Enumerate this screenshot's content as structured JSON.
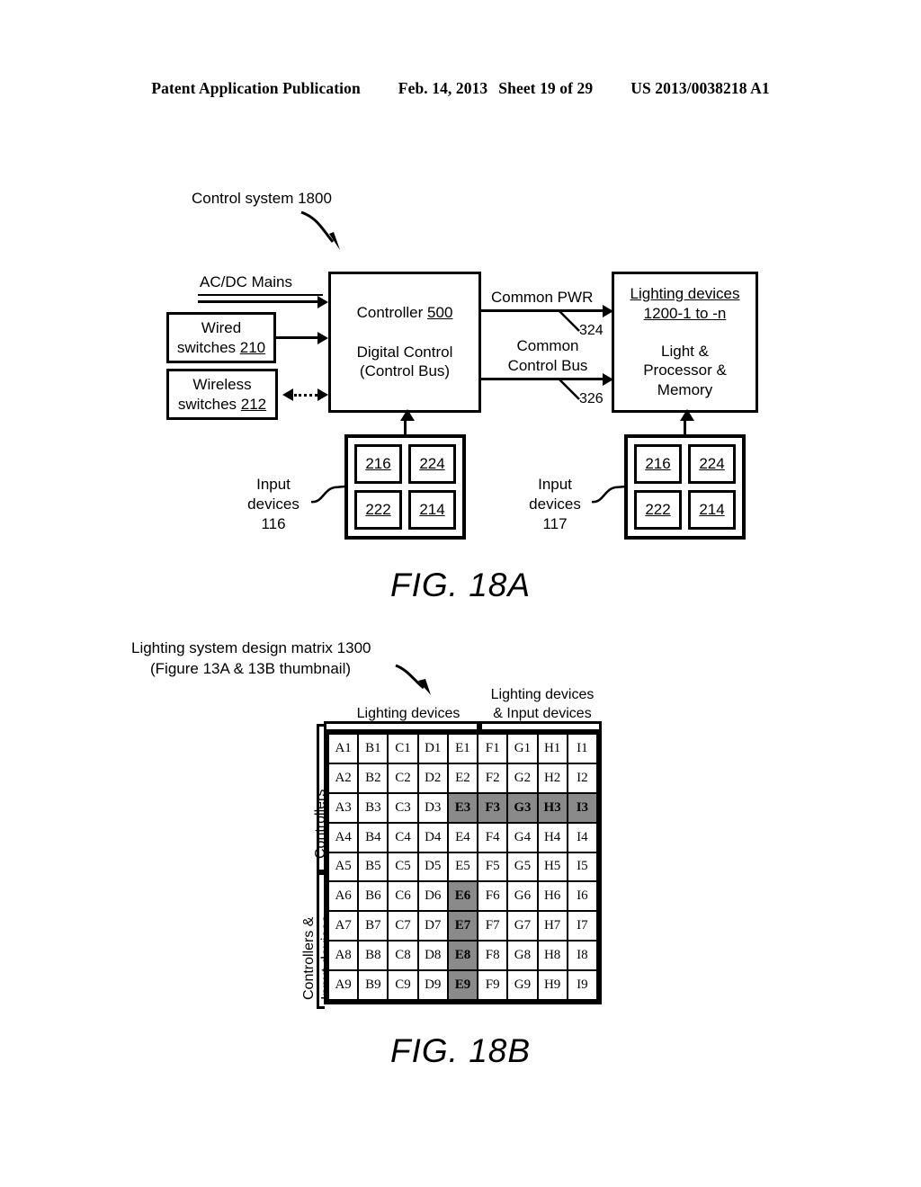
{
  "header": {
    "publication": "Patent Application Publication",
    "date": "Feb. 14, 2013",
    "sheet": "Sheet 19 of 29",
    "number": "US 2013/0038218 A1"
  },
  "fig18a": {
    "caption": "FIG. 18A",
    "system_label": "Control system 1800",
    "mains_label": "AC/DC Mains",
    "wired_switches": {
      "line1": "Wired",
      "line2": "switches",
      "ref": "210"
    },
    "wireless_switches": {
      "line1": "Wireless",
      "line2": "switches",
      "ref": "212"
    },
    "controller": {
      "title": "Controller",
      "ref": "500",
      "line2": "Digital Control",
      "line3": "(Control Bus)"
    },
    "common_pwr_label": "Common PWR",
    "common_pwr_ref": "324",
    "common_control_bus_line1": "Common",
    "common_control_bus_line2": "Control Bus",
    "common_control_bus_ref": "326",
    "lighting_devices": {
      "title": "Lighting devices",
      "ref": "1200-1 to -n",
      "line3": "Light &",
      "line4": "Processor &",
      "line5": "Memory"
    },
    "input_devices_left": {
      "line1": "Input",
      "line2": "devices",
      "ref": "116",
      "cells": [
        "216",
        "224",
        "222",
        "214"
      ]
    },
    "input_devices_right": {
      "line1": "Input",
      "line2": "devices",
      "ref": "117",
      "cells": [
        "216",
        "224",
        "222",
        "214"
      ]
    }
  },
  "fig18b": {
    "caption": "FIG. 18B",
    "title_line1": "Lighting system design matrix 1300",
    "title_line2": "(Figure 13A & 13B thumbnail)",
    "col_group_1": "Lighting devices",
    "col_group_2_line1": "Lighting devices",
    "col_group_2_line2": "& Input devices",
    "row_group_1": "Controllers",
    "row_group_2_line1": "Controllers &",
    "row_group_2_line2": "Input devices",
    "highlight_color": "#8a8a8a",
    "matrix": {
      "columns": [
        "A",
        "B",
        "C",
        "D",
        "E",
        "F",
        "G",
        "H",
        "I"
      ],
      "rows": [
        1,
        2,
        3,
        4,
        5,
        6,
        7,
        8,
        9
      ],
      "cells": [
        [
          {
            "t": "A1",
            "h": false
          },
          {
            "t": "B1",
            "h": false
          },
          {
            "t": "C1",
            "h": false
          },
          {
            "t": "D1",
            "h": false
          },
          {
            "t": "E1",
            "h": false
          },
          {
            "t": "F1",
            "h": false
          },
          {
            "t": "G1",
            "h": false
          },
          {
            "t": "H1",
            "h": false
          },
          {
            "t": "I1",
            "h": false
          }
        ],
        [
          {
            "t": "A2",
            "h": false
          },
          {
            "t": "B2",
            "h": false
          },
          {
            "t": "C2",
            "h": false
          },
          {
            "t": "D2",
            "h": false
          },
          {
            "t": "E2",
            "h": false
          },
          {
            "t": "F2",
            "h": false
          },
          {
            "t": "G2",
            "h": false
          },
          {
            "t": "H2",
            "h": false
          },
          {
            "t": "I2",
            "h": false
          }
        ],
        [
          {
            "t": "A3",
            "h": false
          },
          {
            "t": "B3",
            "h": false
          },
          {
            "t": "C3",
            "h": false
          },
          {
            "t": "D3",
            "h": false
          },
          {
            "t": "E3",
            "h": true
          },
          {
            "t": "F3",
            "h": true
          },
          {
            "t": "G3",
            "h": true
          },
          {
            "t": "H3",
            "h": true
          },
          {
            "t": "I3",
            "h": true
          }
        ],
        [
          {
            "t": "A4",
            "h": false
          },
          {
            "t": "B4",
            "h": false
          },
          {
            "t": "C4",
            "h": false
          },
          {
            "t": "D4",
            "h": false
          },
          {
            "t": "E4",
            "h": false
          },
          {
            "t": "F4",
            "h": false
          },
          {
            "t": "G4",
            "h": false
          },
          {
            "t": "H4",
            "h": false
          },
          {
            "t": "I4",
            "h": false
          }
        ],
        [
          {
            "t": "A5",
            "h": false
          },
          {
            "t": "B5",
            "h": false
          },
          {
            "t": "C5",
            "h": false
          },
          {
            "t": "D5",
            "h": false
          },
          {
            "t": "E5",
            "h": false
          },
          {
            "t": "F5",
            "h": false
          },
          {
            "t": "G5",
            "h": false
          },
          {
            "t": "H5",
            "h": false
          },
          {
            "t": "I5",
            "h": false
          }
        ],
        [
          {
            "t": "A6",
            "h": false
          },
          {
            "t": "B6",
            "h": false
          },
          {
            "t": "C6",
            "h": false
          },
          {
            "t": "D6",
            "h": false
          },
          {
            "t": "E6",
            "h": true
          },
          {
            "t": "F6",
            "h": false
          },
          {
            "t": "G6",
            "h": false
          },
          {
            "t": "H6",
            "h": false
          },
          {
            "t": "I6",
            "h": false
          }
        ],
        [
          {
            "t": "A7",
            "h": false
          },
          {
            "t": "B7",
            "h": false
          },
          {
            "t": "C7",
            "h": false
          },
          {
            "t": "D7",
            "h": false
          },
          {
            "t": "E7",
            "h": true
          },
          {
            "t": "F7",
            "h": false
          },
          {
            "t": "G7",
            "h": false
          },
          {
            "t": "H7",
            "h": false
          },
          {
            "t": "I7",
            "h": false
          }
        ],
        [
          {
            "t": "A8",
            "h": false
          },
          {
            "t": "B8",
            "h": false
          },
          {
            "t": "C8",
            "h": false
          },
          {
            "t": "D8",
            "h": false
          },
          {
            "t": "E8",
            "h": true
          },
          {
            "t": "F8",
            "h": false
          },
          {
            "t": "G8",
            "h": false
          },
          {
            "t": "H8",
            "h": false
          },
          {
            "t": "I8",
            "h": false
          }
        ],
        [
          {
            "t": "A9",
            "h": false
          },
          {
            "t": "B9",
            "h": false
          },
          {
            "t": "C9",
            "h": false
          },
          {
            "t": "D9",
            "h": false
          },
          {
            "t": "E9",
            "h": true
          },
          {
            "t": "F9",
            "h": false
          },
          {
            "t": "G9",
            "h": false
          },
          {
            "t": "H9",
            "h": false
          },
          {
            "t": "I9",
            "h": false
          }
        ]
      ]
    }
  }
}
